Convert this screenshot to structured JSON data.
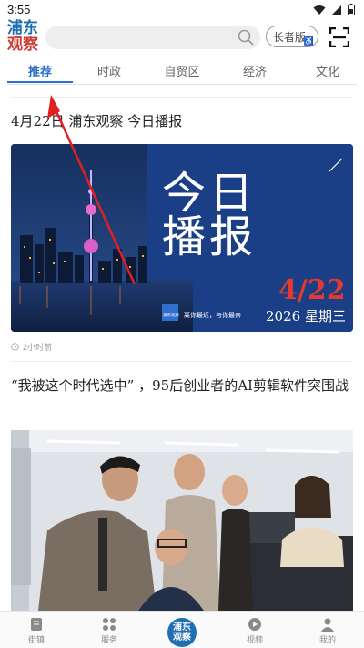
{
  "status_bar": {
    "time": "3:55"
  },
  "header": {
    "logo_line1": "浦东",
    "logo_line2": "观察",
    "elder_mode_label": "长者版"
  },
  "tabs": [
    {
      "label": "推荐",
      "active": true
    },
    {
      "label": "时政",
      "active": false
    },
    {
      "label": "自贸区",
      "active": false
    },
    {
      "label": "经济",
      "active": false
    },
    {
      "label": "文化",
      "active": false
    }
  ],
  "feed": [
    {
      "title": "4月22日 浦东观察  今日播报",
      "image": {
        "headline_line1": "今日",
        "headline_line2": "播报",
        "date": "4/22",
        "year_weekday": "2026 星期三",
        "badge_text": "浦东观察",
        "slogan": "离你最近，与你最亲"
      },
      "time_ago": "2小时前"
    },
    {
      "title": "“我被这个时代选中” ，95后创业者的AI剪辑软件突围战"
    }
  ],
  "bottom_nav": [
    {
      "label": "街镇",
      "icon": "document-icon"
    },
    {
      "label": "服务",
      "icon": "grid-icon"
    },
    {
      "label": "视频",
      "icon": "play-icon"
    },
    {
      "label": "我的",
      "icon": "person-icon"
    }
  ],
  "bottom_nav_center": {
    "line1": "浦东",
    "line2": "观察"
  },
  "colors": {
    "accent": "#2a6fc9",
    "annotation_arrow": "#e02020"
  }
}
